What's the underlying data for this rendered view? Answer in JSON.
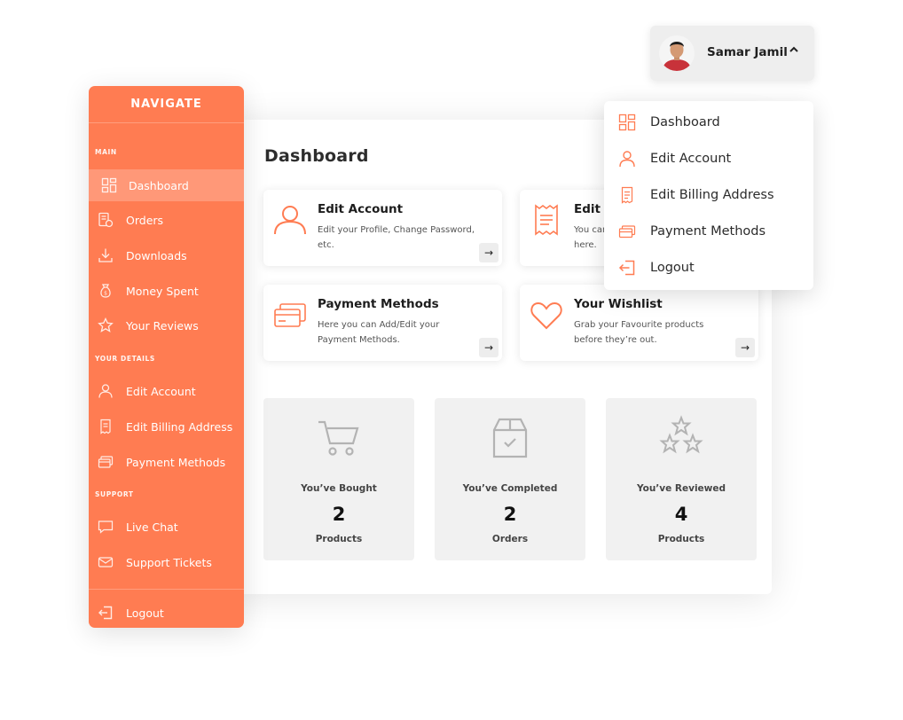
{
  "colors": {
    "accent": "#ff7c52",
    "tile_bg": "#f1f1f1",
    "text_dark": "#1d1d1d"
  },
  "user": {
    "name": "Samar Jamil",
    "caret_icon": "chevron-up-icon"
  },
  "dropdown": {
    "items": [
      {
        "label": "Dashboard",
        "icon": "dashboard-grid-icon"
      },
      {
        "label": "Edit Account",
        "icon": "user-icon"
      },
      {
        "label": "Edit Billing Address",
        "icon": "receipt-icon"
      },
      {
        "label": "Payment Methods",
        "icon": "credit-card-icon"
      },
      {
        "label": "Logout",
        "icon": "logout-icon"
      }
    ]
  },
  "sidebar": {
    "header": "NAVIGATE",
    "sections": {
      "main": "MAIN",
      "details": "YOUR DETAILS",
      "support": "SUPPORT"
    },
    "items": [
      {
        "label": "Dashboard",
        "icon": "dashboard-grid-icon",
        "active": true
      },
      {
        "label": "Orders",
        "icon": "orders-icon"
      },
      {
        "label": "Downloads",
        "icon": "download-icon"
      },
      {
        "label": "Money Spent",
        "icon": "money-bag-icon"
      },
      {
        "label": "Your Reviews",
        "icon": "star-icon"
      },
      {
        "label": "Edit Account",
        "icon": "user-icon"
      },
      {
        "label": "Edit Billing Address",
        "icon": "receipt-icon"
      },
      {
        "label": "Payment Methods",
        "icon": "credit-card-icon"
      },
      {
        "label": "Live Chat",
        "icon": "chat-icon"
      },
      {
        "label": "Support Tickets",
        "icon": "envelope-icon"
      },
      {
        "label": "Logout",
        "icon": "logout-icon"
      }
    ]
  },
  "main": {
    "title": "Dashboard",
    "cards": [
      {
        "title": "Edit Account",
        "desc": "Edit your Profile, Change Password, etc.",
        "icon": "user-icon",
        "arrow": "→"
      },
      {
        "title": "Edit Billing Address",
        "desc": "You can Add/Edit your Address here.",
        "icon": "receipt-icon",
        "arrow": "→"
      },
      {
        "title": "Payment Methods",
        "desc": "Here you can Add/Edit your Payment Methods.",
        "icon": "credit-card-icon",
        "arrow": "→"
      },
      {
        "title": "Your Wishlist",
        "desc": "Grab your Favourite products before they’re out.",
        "icon": "heart-icon",
        "arrow": "→"
      }
    ],
    "stats": [
      {
        "label": "You’ve Bought",
        "value": "2",
        "unit": "Products",
        "icon": "cart-icon"
      },
      {
        "label": "You’ve Completed",
        "value": "2",
        "unit": "Orders",
        "icon": "box-check-icon"
      },
      {
        "label": "You’ve Reviewed",
        "value": "4",
        "unit": "Products",
        "icon": "stars-icon"
      }
    ]
  }
}
